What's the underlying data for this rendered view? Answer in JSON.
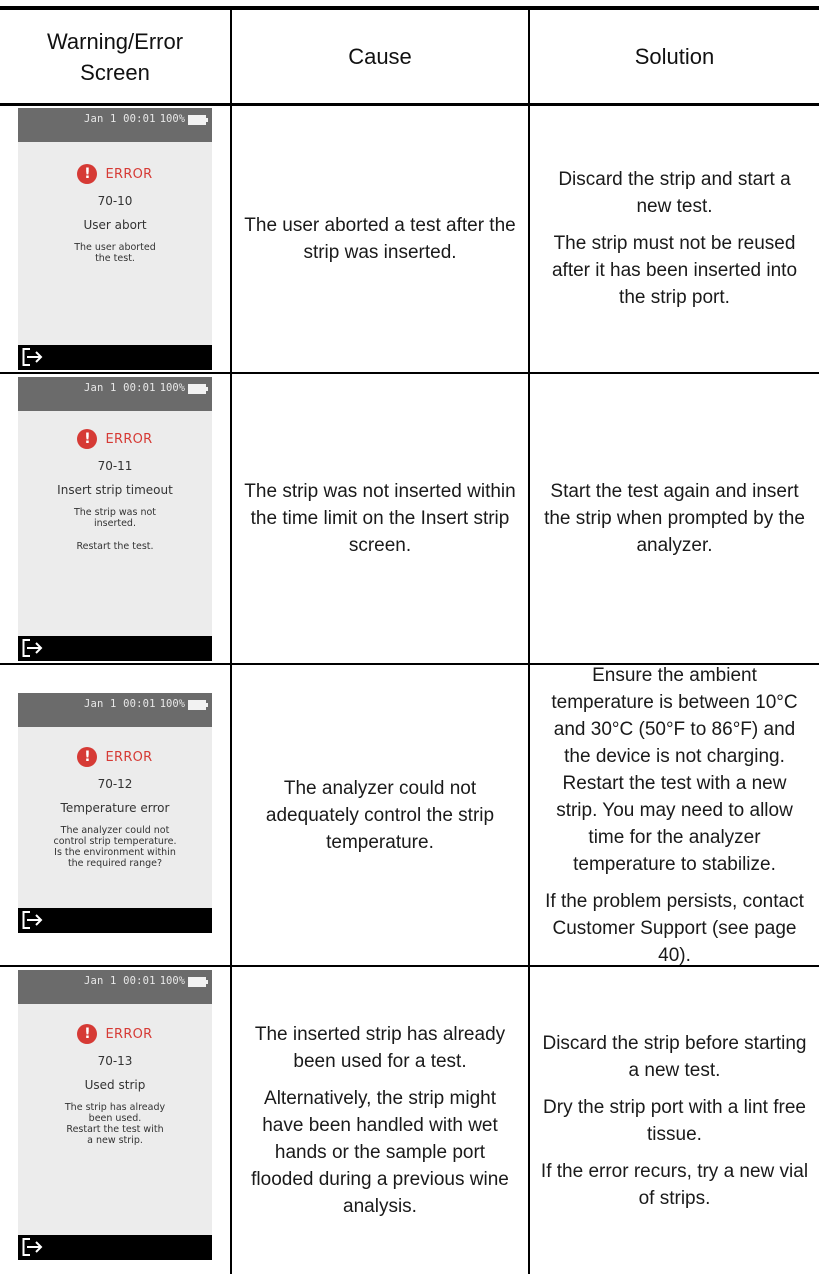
{
  "headers": {
    "screen": "Warning/Error Screen",
    "cause": "Cause",
    "solution": "Solution"
  },
  "rows": [
    {
      "screen": {
        "status_date": "Jan 1 00:01",
        "status_battery": "100%",
        "error_label": "ERROR",
        "code": "70-10",
        "title": "User abort",
        "description": "The user aborted\nthe test.",
        "extra": "",
        "exit_icon": "exit-arrow-icon"
      },
      "cause": [
        "The user aborted a test after the strip was inserted."
      ],
      "solution": [
        "Discard the strip and start a new test.",
        "The strip must not be reused after it has been inserted into the strip port."
      ]
    },
    {
      "screen": {
        "status_date": "Jan 1 00:01",
        "status_battery": "100%",
        "error_label": "ERROR",
        "code": "70-11",
        "title": "Insert strip timeout",
        "description": "The strip was not\ninserted.",
        "extra": "Restart the test.",
        "exit_icon": "exit-arrow-icon"
      },
      "cause": [
        "The strip was not inserted within the time limit on the Insert strip screen."
      ],
      "solution": [
        "Start the test again and insert the strip when prompted by the analyzer."
      ]
    },
    {
      "screen": {
        "status_date": "Jan 1 00:01",
        "status_battery": "100%",
        "error_label": "ERROR",
        "code": "70-12",
        "title": "Temperature error",
        "description": "The analyzer could not\ncontrol strip temperature.\nIs the environment within\nthe required range?",
        "extra": "",
        "exit_icon": "exit-arrow-icon"
      },
      "cause": [
        "The analyzer could not adequately control the strip temperature."
      ],
      "solution": [
        "Ensure the ambient temperature is between 10°C and 30°C (50°F to 86°F) and the device is not charging. Restart the test with a new strip. You may need to allow time for the analyzer temperature to stabilize.",
        "If the problem persists, contact Customer Support (see page 40)."
      ]
    },
    {
      "screen": {
        "status_date": "Jan 1 00:01",
        "status_battery": "100%",
        "error_label": "ERROR",
        "code": "70-13",
        "title": "Used strip",
        "description": "The strip has already\nbeen used.\nRestart the test with\na new strip.",
        "extra": "",
        "exit_icon": "exit-arrow-icon"
      },
      "cause": [
        "The inserted strip has already been used for a test.",
        "Alternatively, the strip might have been handled with wet hands or the sample port flooded during a previous wine analysis."
      ],
      "solution": [
        "Discard the strip before starting a new test.",
        "Dry the strip port with a lint free tissue.",
        "If the error recurs, try a new vial of strips."
      ]
    }
  ],
  "colors": {
    "error_red": "#d63a35",
    "status_bar": "#6b6b6b",
    "screen_bg": "#ececec"
  }
}
